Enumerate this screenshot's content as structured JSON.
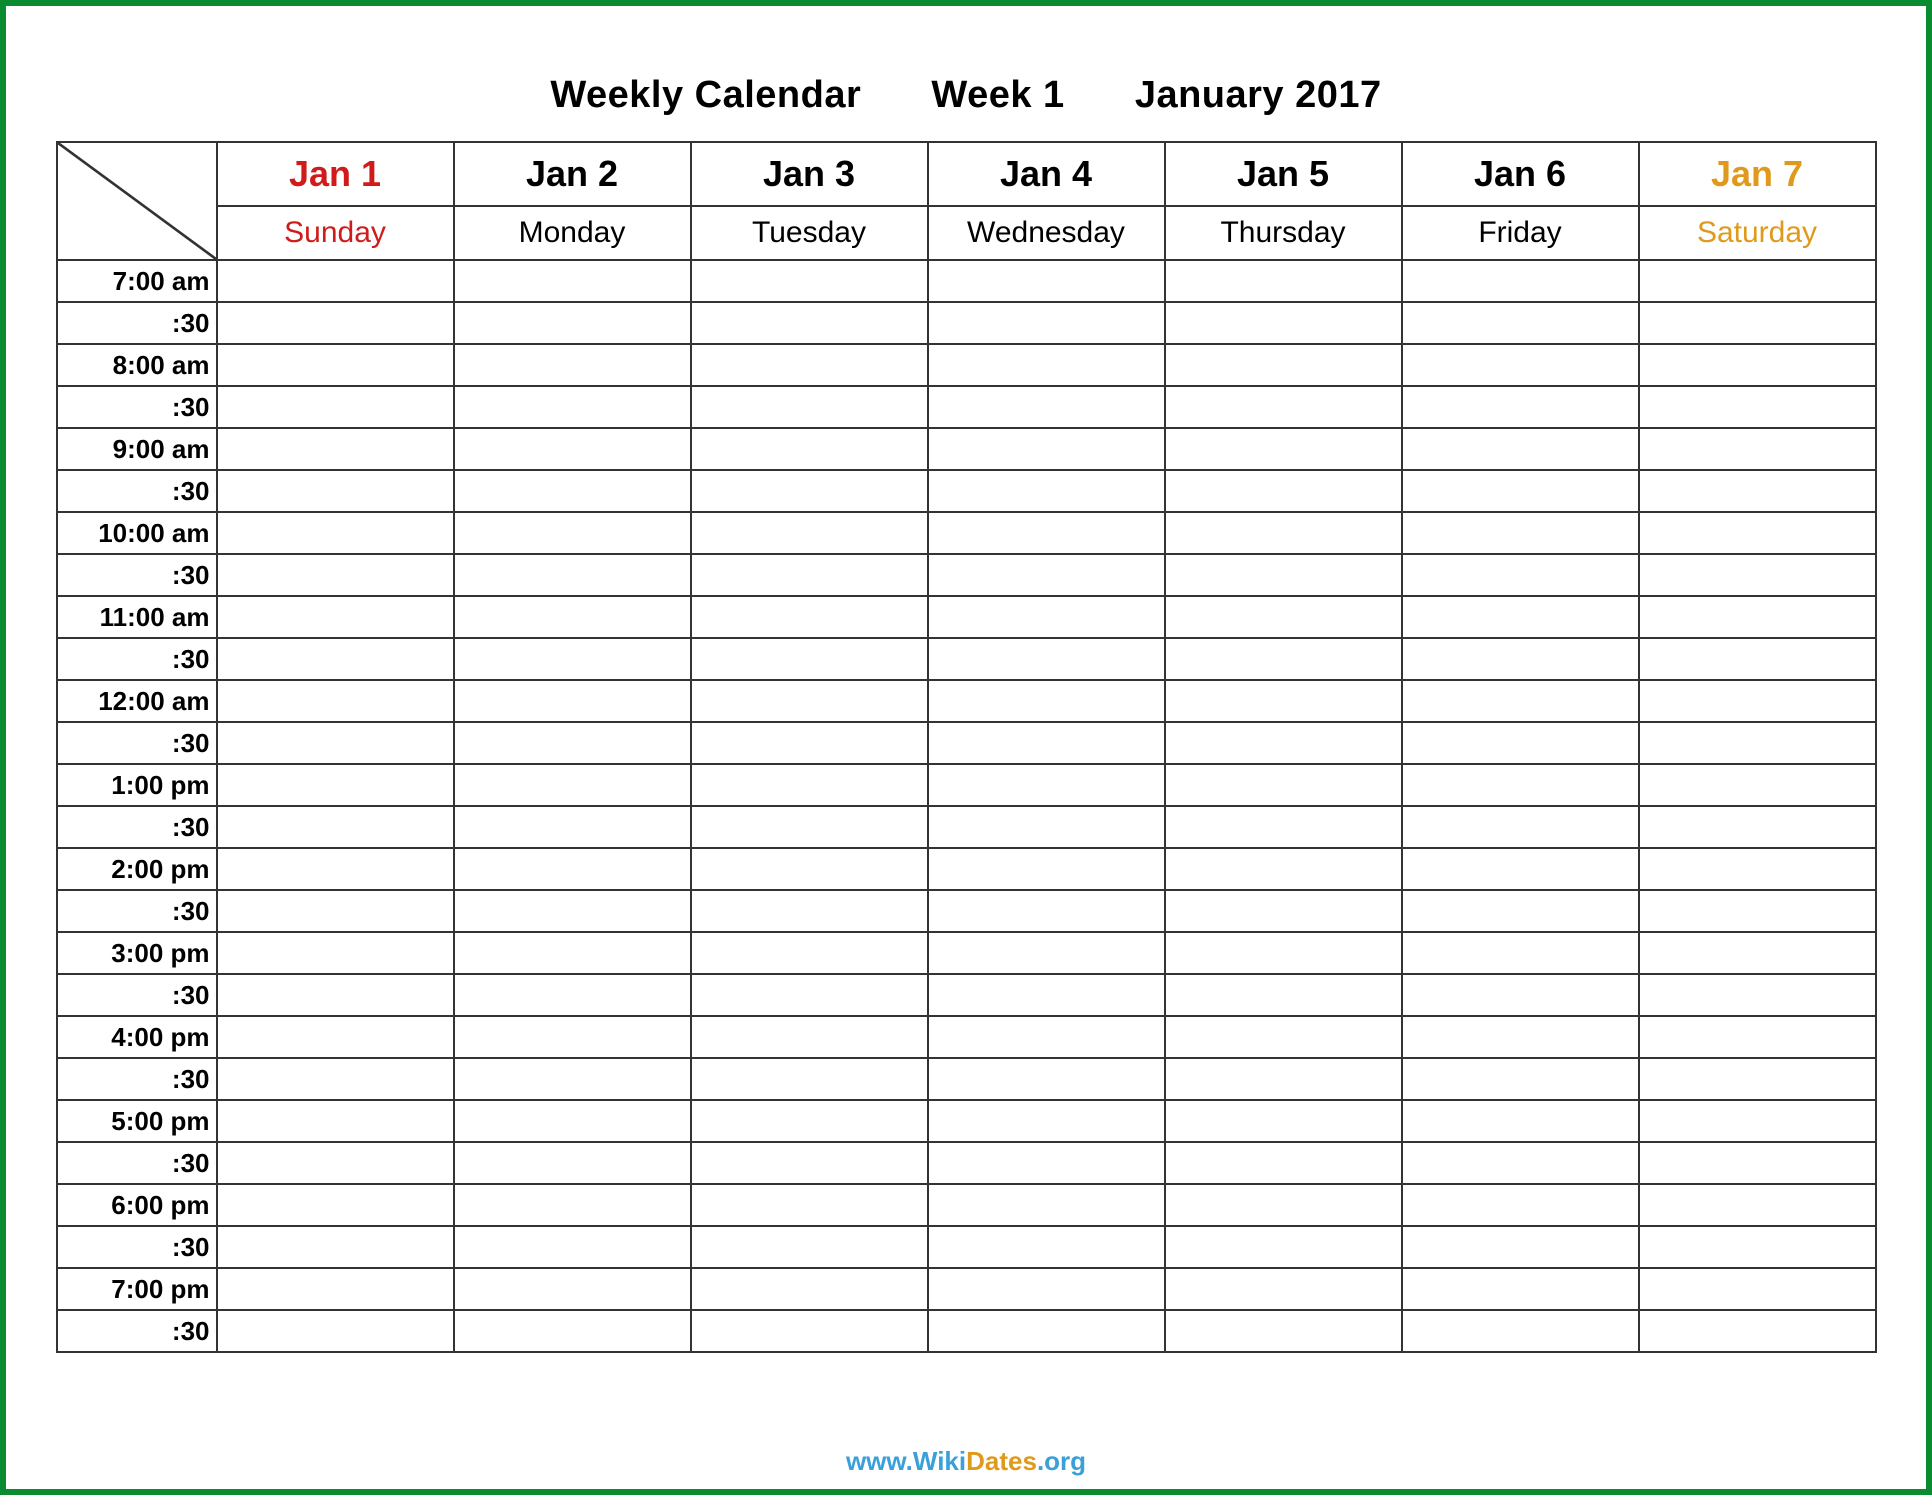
{
  "title": {
    "line1": "Weekly Calendar",
    "line2": "Week 1",
    "line3": "January 2017"
  },
  "days": [
    {
      "date": "Jan 1",
      "dow": "Sunday",
      "class": "sunday"
    },
    {
      "date": "Jan 2",
      "dow": "Monday",
      "class": "normal"
    },
    {
      "date": "Jan 3",
      "dow": "Tuesday",
      "class": "normal"
    },
    {
      "date": "Jan 4",
      "dow": "Wednesday",
      "class": "normal"
    },
    {
      "date": "Jan 5",
      "dow": "Thursday",
      "class": "normal"
    },
    {
      "date": "Jan 6",
      "dow": "Friday",
      "class": "normal"
    },
    {
      "date": "Jan 7",
      "dow": "Saturday",
      "class": "saturday"
    }
  ],
  "time_slots": [
    "7:00 am",
    ":30",
    "8:00 am",
    ":30",
    "9:00 am",
    ":30",
    "10:00 am",
    ":30",
    "11:00 am",
    ":30",
    "12:00 am",
    ":30",
    "1:00 pm",
    ":30",
    "2:00 pm",
    ":30",
    "3:00 pm",
    ":30",
    "4:00 pm",
    ":30",
    "5:00 pm",
    ":30",
    "6:00 pm",
    ":30",
    "7:00 pm",
    ":30"
  ],
  "footer": {
    "www": "www.",
    "wiki": "Wiki",
    "dates": "Dates",
    "org": ".org"
  }
}
